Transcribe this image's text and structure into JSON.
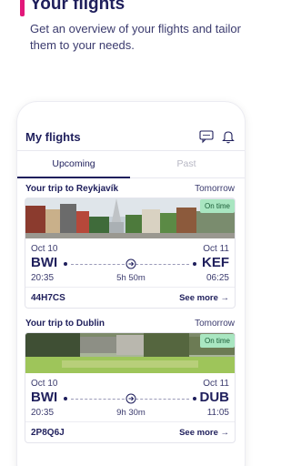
{
  "hero": {
    "title": "Your flights",
    "subtitle": "Get an overview of your flights and tailor them to your needs."
  },
  "app": {
    "title": "My flights",
    "tabs": [
      {
        "label": "Upcoming",
        "active": true
      },
      {
        "label": "Past",
        "active": false
      }
    ],
    "icons": [
      "chat-icon",
      "bell-icon"
    ]
  },
  "trips": [
    {
      "label": "Your trip to Reykjavík",
      "when": "Tomorrow",
      "status": "On time",
      "depart_date": "Oct 10",
      "arrive_date": "Oct 11",
      "from": "BWI",
      "to": "KEF",
      "depart_time": "20:35",
      "arrive_time": "06:25",
      "duration": "5h 50m",
      "booking_ref": "44H7CS",
      "see_more": "See more →"
    },
    {
      "label": "Your trip to Dublin",
      "when": "Tomorrow",
      "status": "On time",
      "depart_date": "Oct 10",
      "arrive_date": "Oct 11",
      "from": "BWI",
      "to": "DUB",
      "depart_time": "20:35",
      "arrive_time": "11:05",
      "duration": "9h 30m",
      "booking_ref": "2P8Q6J",
      "see_more": "See more →"
    }
  ],
  "colors": {
    "brand_navy": "#1f1f5c",
    "accent_pink": "#e2187a",
    "ontime_bg": "#a9e6c1"
  }
}
